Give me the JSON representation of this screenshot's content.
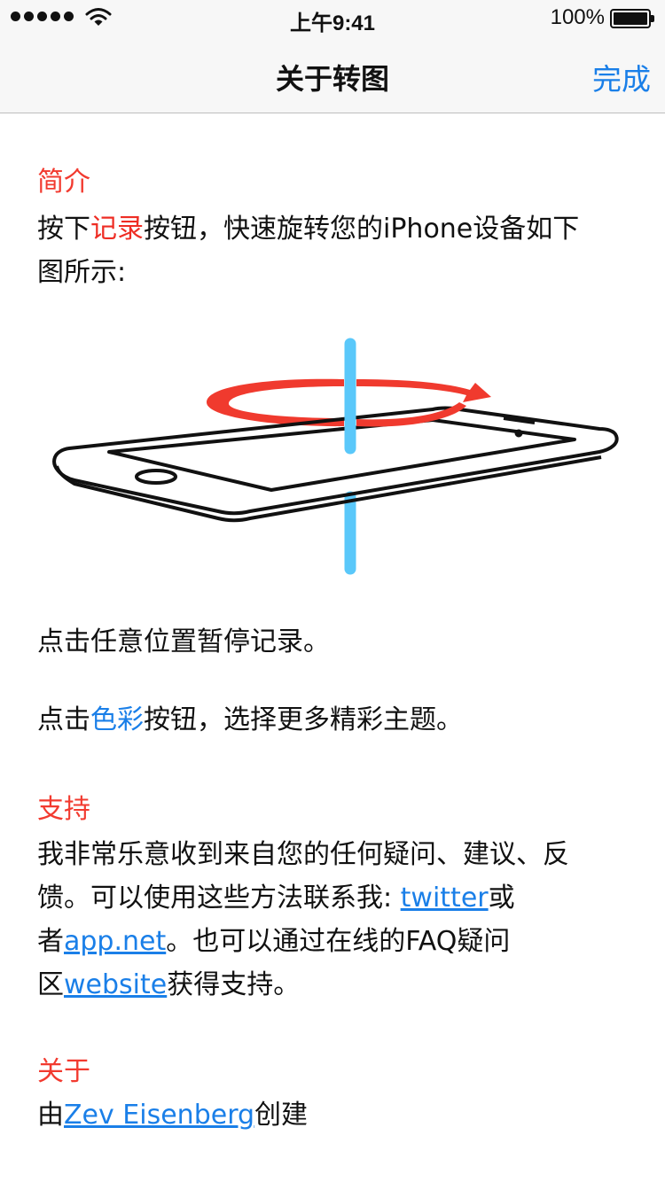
{
  "status_bar": {
    "time": "上午9:41",
    "battery_percent": "100%",
    "battery_level": 1.0,
    "signal_bars": 5
  },
  "nav": {
    "title": "关于转图",
    "done_label": "完成"
  },
  "intro": {
    "heading": "简介",
    "line1_a": "按下",
    "line1_record": "记录",
    "line1_b": "按钮，快速旋转您的iPhone设备如下",
    "line2": "图所示:",
    "pause_text": "点击任意位置暂停记录。",
    "color_a": "点击",
    "color_link": "色彩",
    "color_b": "按钮，选择更多精彩主题。"
  },
  "support": {
    "heading": "支持",
    "line1": "我非常乐意收到来自您的任何疑问、建议、反",
    "line2_a": "馈。可以使用这些方法联系我: ",
    "twitter": "twitter",
    "line2_b": "或",
    "line3_a": "者",
    "appnet": "app.net",
    "line3_b": "。也可以通过在线的FAQ疑问",
    "line4_a": "区",
    "website": "website",
    "line4_b": "获得支持。"
  },
  "about": {
    "heading": "关于",
    "line_a": "由",
    "author": "Zev Eisenberg",
    "line_b": "创建"
  },
  "colors": {
    "accent_blue": "#1a7fe8",
    "heading_red": "#f23a2f",
    "axis_blue": "#5ac8fa"
  }
}
